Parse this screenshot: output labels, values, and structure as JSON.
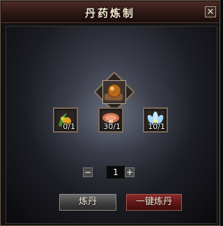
{
  "window": {
    "title": "丹药炼制",
    "close_label": "✕"
  },
  "result_item": {
    "icon": "elixir-orb-icon"
  },
  "materials": [
    {
      "icon": "herb-fruit-icon",
      "count": "0/1"
    },
    {
      "icon": "mushroom-icon",
      "count": "30/1"
    },
    {
      "icon": "lotus-flower-icon",
      "count": "10/1"
    }
  ],
  "quantity": {
    "decrease_label": "−",
    "value": "1",
    "increase_label": "+"
  },
  "buttons": {
    "refine_label": "炼丹",
    "one_click_label": "一键炼丹"
  },
  "colors": {
    "title_bar": "#3a1e1a",
    "one_click_button": "#6a1c1a",
    "refine_button": "#4a4a4a"
  }
}
